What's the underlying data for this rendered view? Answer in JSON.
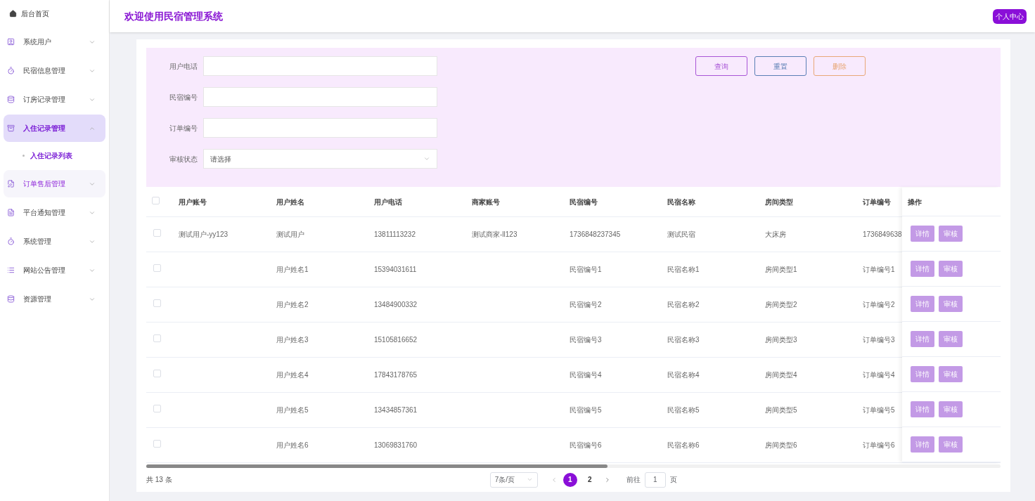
{
  "sidebar": {
    "home": "后台首页",
    "items": [
      {
        "label": "系统用户",
        "expanded": false,
        "hovered": false
      },
      {
        "label": "民宿信息管理",
        "expanded": false,
        "hovered": false
      },
      {
        "label": "订房记录管理",
        "expanded": false,
        "hovered": false
      },
      {
        "label": "入住记录管理",
        "expanded": true,
        "hovered": false,
        "children": [
          {
            "label": "入住记录列表",
            "selected": true
          }
        ]
      },
      {
        "label": "订单售后管理",
        "expanded": false,
        "hovered": true
      },
      {
        "label": "平台通知管理",
        "expanded": false,
        "hovered": false
      },
      {
        "label": "系统管理",
        "expanded": false,
        "hovered": false
      },
      {
        "label": "网站公告管理",
        "expanded": false,
        "hovered": false
      },
      {
        "label": "资源管理",
        "expanded": false,
        "hovered": false
      }
    ]
  },
  "header": {
    "title": "欢迎使用民宿管理系统",
    "profile_button": "个人中心"
  },
  "filters": [
    {
      "label": "用户电话",
      "kind": "input"
    },
    {
      "label": "民宿编号",
      "kind": "input"
    },
    {
      "label": "订单编号",
      "kind": "input"
    },
    {
      "label": "审核状态",
      "kind": "select",
      "placeholder": "请选择"
    }
  ],
  "actions": [
    {
      "label": "查询",
      "color": "#a855d6"
    },
    {
      "label": "重置",
      "color": "#5b7fb5"
    },
    {
      "label": "删除",
      "color": "#e8a878"
    }
  ],
  "table": {
    "columns": [
      "用户账号",
      "用户姓名",
      "用户电话",
      "商家账号",
      "民宿编号",
      "民宿名称",
      "房间类型",
      "订单编号"
    ],
    "ops_header": "操作",
    "all_checked": false,
    "rows": [
      {
        "checked": false,
        "cells": [
          "测试用户-yy123",
          "测试用户",
          "13811113232",
          "测试商家-ll123",
          "1736848237345",
          "测试民宿",
          "大床房",
          "1736849638"
        ],
        "buttons": [
          "详情",
          "审核"
        ]
      },
      {
        "checked": false,
        "cells": [
          "",
          "用户姓名1",
          "15394031611",
          "",
          "民宿编号1",
          "民宿名称1",
          "房间类型1",
          "订单编号1"
        ],
        "buttons": [
          "详情",
          "审核"
        ]
      },
      {
        "checked": false,
        "cells": [
          "",
          "用户姓名2",
          "13484900332",
          "",
          "民宿编号2",
          "民宿名称2",
          "房间类型2",
          "订单编号2"
        ],
        "buttons": [
          "详情",
          "审核"
        ]
      },
      {
        "checked": false,
        "cells": [
          "",
          "用户姓名3",
          "15105816652",
          "",
          "民宿编号3",
          "民宿名称3",
          "房间类型3",
          "订单编号3"
        ],
        "buttons": [
          "详情",
          "审核"
        ]
      },
      {
        "checked": false,
        "cells": [
          "",
          "用户姓名4",
          "17843178765",
          "",
          "民宿编号4",
          "民宿名称4",
          "房间类型4",
          "订单编号4"
        ],
        "buttons": [
          "详情",
          "审核"
        ]
      },
      {
        "checked": false,
        "cells": [
          "",
          "用户姓名5",
          "13434857361",
          "",
          "民宿编号5",
          "民宿名称5",
          "房间类型5",
          "订单编号5"
        ],
        "buttons": [
          "详情",
          "审核"
        ]
      },
      {
        "checked": false,
        "cells": [
          "",
          "用户姓名6",
          "13069831760",
          "",
          "民宿编号6",
          "民宿名称6",
          "房间类型6",
          "订单编号6"
        ],
        "buttons": [
          "详情",
          "审核"
        ]
      }
    ]
  },
  "pagination": {
    "total": "共 13 条",
    "page_size": "7条/页",
    "pages": [
      {
        "label": "1",
        "selected": true
      },
      {
        "label": "2",
        "selected": false
      }
    ],
    "goto_label": "前往",
    "goto_value": "1",
    "goto_suffix": "页"
  }
}
